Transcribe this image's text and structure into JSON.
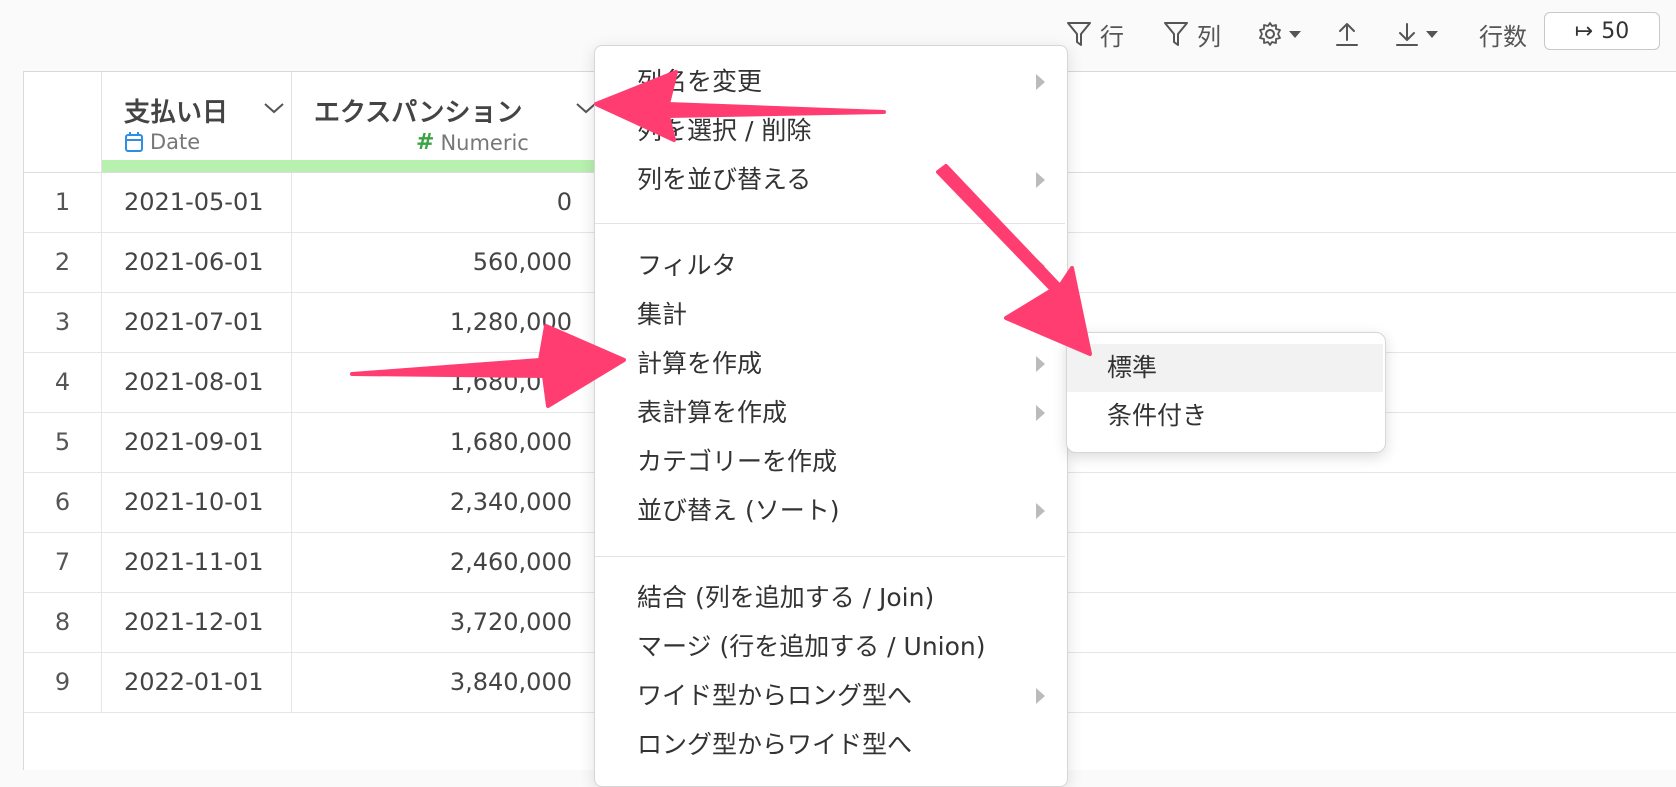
{
  "toolbar": {
    "row_filter_label": "行",
    "column_filter_label": "列",
    "rows_count_label": "行数",
    "rows_count_value": "50",
    "rows_count_glyph": "↦"
  },
  "table": {
    "columns": [
      {
        "name": "支払い日",
        "type_label": "Date",
        "type_icon": "calendar-icon"
      },
      {
        "name": "エクスパンション",
        "type_label": "Numeric",
        "type_icon": "hash-icon"
      }
    ],
    "rows": [
      {
        "index": "1",
        "date": "2021-05-01",
        "value": "0"
      },
      {
        "index": "2",
        "date": "2021-06-01",
        "value": "560,000"
      },
      {
        "index": "3",
        "date": "2021-07-01",
        "value": "1,280,000"
      },
      {
        "index": "4",
        "date": "2021-08-01",
        "value": "1,680,000"
      },
      {
        "index": "5",
        "date": "2021-09-01",
        "value": "1,680,000"
      },
      {
        "index": "6",
        "date": "2021-10-01",
        "value": "2,340,000"
      },
      {
        "index": "7",
        "date": "2021-11-01",
        "value": "2,460,000"
      },
      {
        "index": "8",
        "date": "2021-12-01",
        "value": "3,720,000"
      },
      {
        "index": "9",
        "date": "2022-01-01",
        "value": "3,840,000"
      }
    ]
  },
  "menu": {
    "items": [
      {
        "label": "列名を変更",
        "has_submenu": true
      },
      {
        "label": "列を選択 / 削除",
        "has_submenu": false
      },
      {
        "label": "列を並び替える",
        "has_submenu": true
      },
      {
        "label": "フィルタ",
        "has_submenu": true
      },
      {
        "label": "集計",
        "has_submenu": false
      },
      {
        "label": "計算を作成",
        "has_submenu": true
      },
      {
        "label": "表計算を作成",
        "has_submenu": true
      },
      {
        "label": "カテゴリーを作成",
        "has_submenu": false
      },
      {
        "label": "並び替え (ソート)",
        "has_submenu": true
      },
      {
        "label": "結合 (列を追加する / Join)",
        "has_submenu": false
      },
      {
        "label": "マージ (行を追加する / Union)",
        "has_submenu": false
      },
      {
        "label": "ワイド型からロング型へ",
        "has_submenu": true
      },
      {
        "label": "ロング型からワイド型へ",
        "has_submenu": false
      }
    ]
  },
  "submenu": {
    "items": [
      {
        "label": "標準",
        "highlighted": true
      },
      {
        "label": "条件付き",
        "highlighted": false
      }
    ]
  },
  "colors": {
    "annotation_arrow": "#ff3d71",
    "type_bar": "#b8f0b0",
    "date_icon": "#2f8de4",
    "numeric_icon": "#3aa344"
  }
}
